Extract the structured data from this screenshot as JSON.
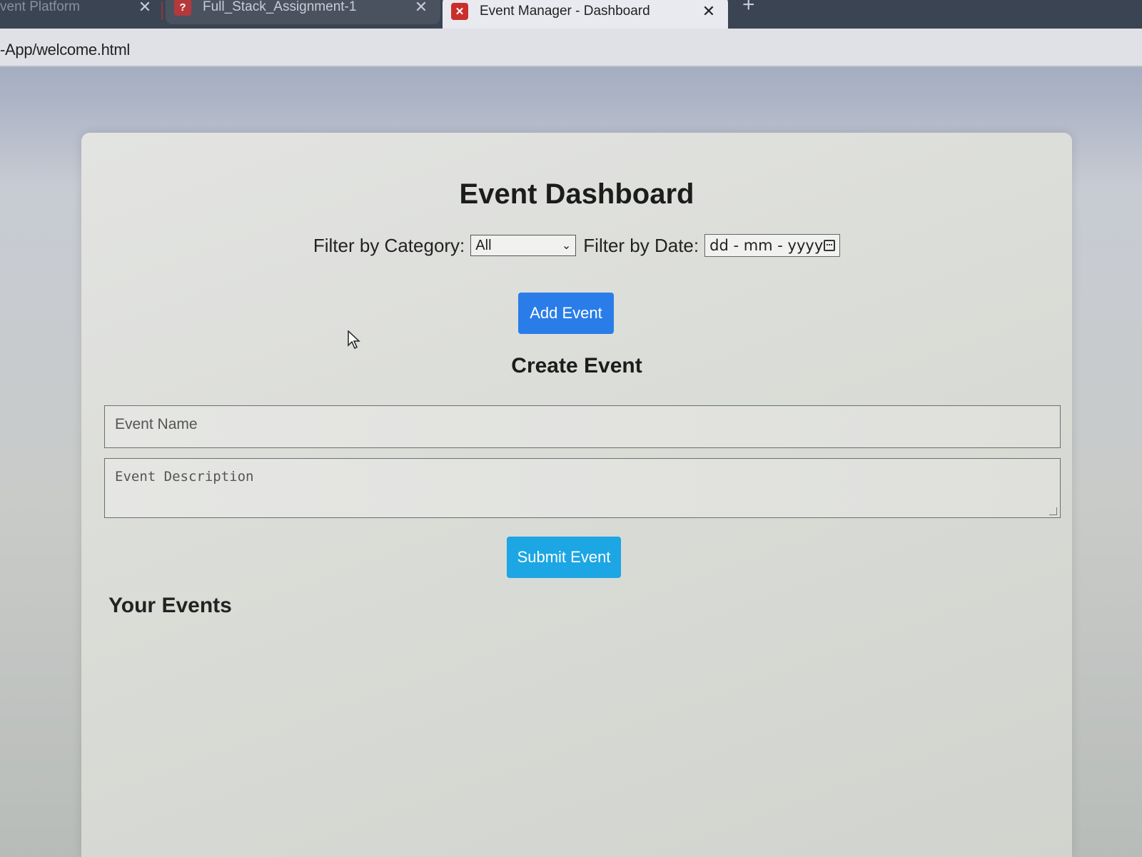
{
  "browser": {
    "tabs": [
      {
        "title": "vent Platform"
      },
      {
        "title": "Full_Stack_Assignment-1"
      },
      {
        "title": "Event Manager - Dashboard"
      }
    ],
    "url": "-App/welcome.html"
  },
  "page": {
    "title": "Event Dashboard",
    "filters": {
      "category_label": "Filter by Category:",
      "category_value": "All",
      "date_label": "Filter by Date:",
      "date_placeholder": "dd - mm - yyyy"
    },
    "add_event_label": "Add Event",
    "create_heading": "Create Event",
    "form": {
      "name_placeholder": "Event Name",
      "description_placeholder": "Event Description",
      "submit_label": "Submit Event"
    },
    "events_heading": "Your Events"
  },
  "colors": {
    "add_button": "#2a7de8",
    "submit_button": "#1ca6e4"
  }
}
